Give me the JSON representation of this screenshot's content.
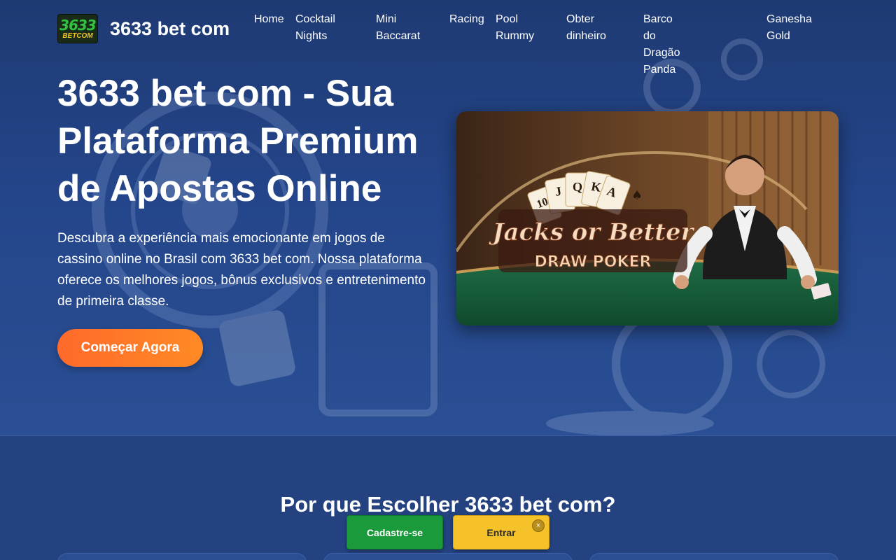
{
  "brand": {
    "logo_main": "3633",
    "logo_sub": "BETCOM",
    "title": "3633 bet com"
  },
  "nav": {
    "items": [
      {
        "line1": "Home",
        "line2": ""
      },
      {
        "line1": "Cocktail",
        "line2": "Nights"
      },
      {
        "line1": "Mini",
        "line2": "Baccarat"
      },
      {
        "line1": "Racing",
        "line2": ""
      },
      {
        "line1": "Pool",
        "line2": "Rummy"
      },
      {
        "line1": "Obter",
        "line2": "dinheiro"
      },
      {
        "line1": "Barco do Dragão",
        "line2": "Panda"
      },
      {
        "line1": "Ganesha",
        "line2": "Gold"
      }
    ]
  },
  "hero": {
    "title": "3633 bet com - Sua Plataforma Premium de Apostas Online",
    "description": "Descubra a experiência mais emocionante em jogos de cassino online no Brasil com 3633 bet com. Nossa plataforma oferece os melhores jogos, bônus exclusivos e entretenimento de primeira classe.",
    "cta_label": "Começar Agora",
    "image": {
      "cards": [
        "10",
        "J",
        "Q",
        "K",
        "A",
        "♠"
      ],
      "game_title": "Jacks or Better",
      "game_subtitle": "DRAW POKER"
    }
  },
  "section": {
    "title": "Por que Escolher 3633 bet com?"
  },
  "sticky": {
    "register_label": "Cadastre-se",
    "login_label": "Entrar",
    "close_symbol": "×"
  },
  "colors": {
    "background": "#23427f",
    "cta_gradient_start": "#ff6a2b",
    "cta_gradient_end": "#ff8a24",
    "register_green": "#1a9a3a",
    "login_yellow": "#f6c22a"
  },
  "icons": {
    "close": "close-icon"
  }
}
